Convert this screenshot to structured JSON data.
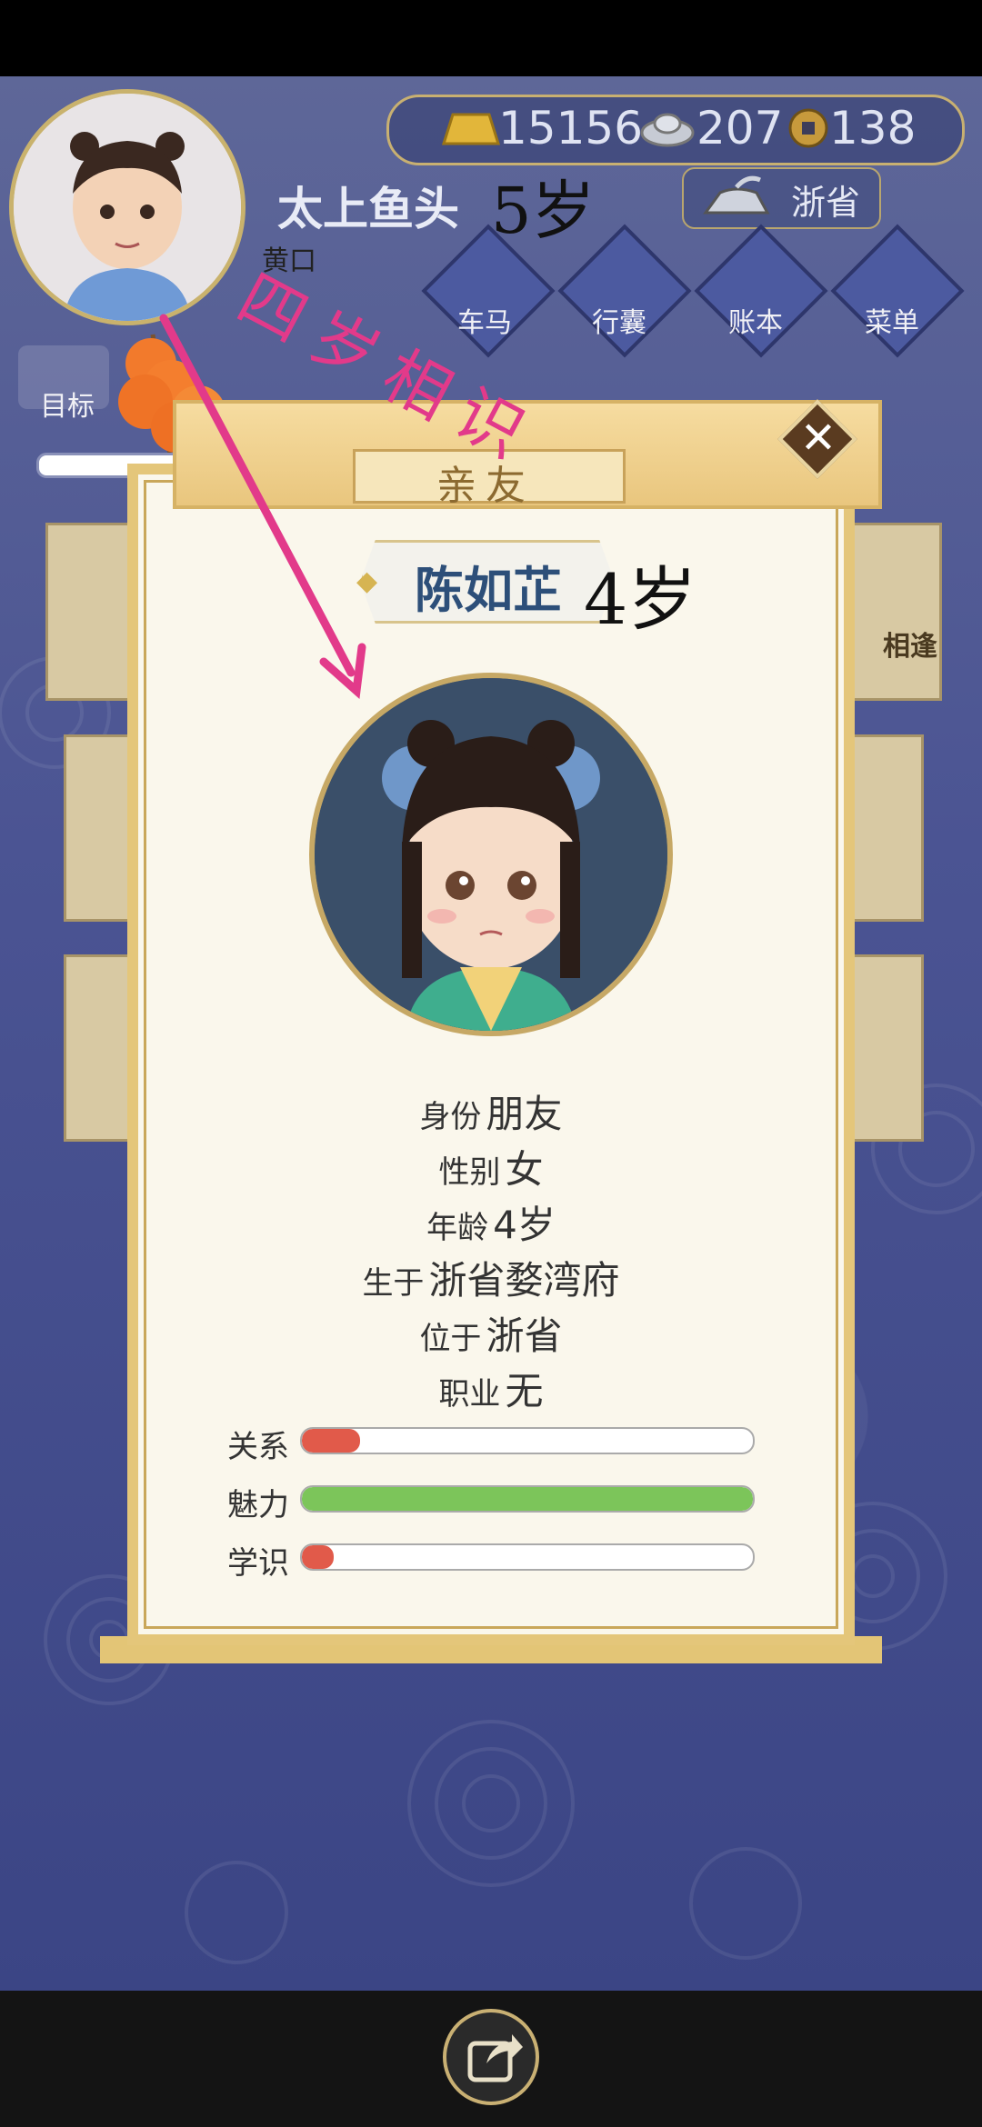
{
  "currency": {
    "gold": "15156",
    "silver": "207",
    "copper": "138"
  },
  "player": {
    "name": "太上鱼头",
    "age_handwritten": "5岁",
    "status": "黄口",
    "location": "浙省"
  },
  "nav": [
    {
      "label": "车马",
      "icon": "carriage-icon"
    },
    {
      "label": "行囊",
      "icon": "bag-icon"
    },
    {
      "label": "账本",
      "icon": "ledger-icon"
    },
    {
      "label": "菜单",
      "icon": "menu-dots-icon"
    }
  ],
  "left_menu": {
    "label": "目标"
  },
  "side_card_text": "相逢",
  "panel": {
    "title": "亲友",
    "npc_name": "陈如芷",
    "npc_age_handwritten": "4岁",
    "info": [
      {
        "key": "身份",
        "value": "朋友"
      },
      {
        "key": "性别",
        "value": "女"
      },
      {
        "key": "年龄",
        "value": "4岁"
      },
      {
        "key": "生于",
        "value": "浙省婺湾府"
      },
      {
        "key": "位于",
        "value": "浙省"
      },
      {
        "key": "职业",
        "value": "无"
      }
    ],
    "stats": [
      {
        "label": "关系",
        "fraction": 0.13,
        "color": "#e15a4a"
      },
      {
        "label": "魅力",
        "fraction": 1.0,
        "color": "#7cc55a"
      },
      {
        "label": "学识",
        "fraction": 0.07,
        "color": "#e15a4a"
      }
    ]
  },
  "annotation": {
    "text": "四岁相识",
    "color": "#e23a8a"
  }
}
